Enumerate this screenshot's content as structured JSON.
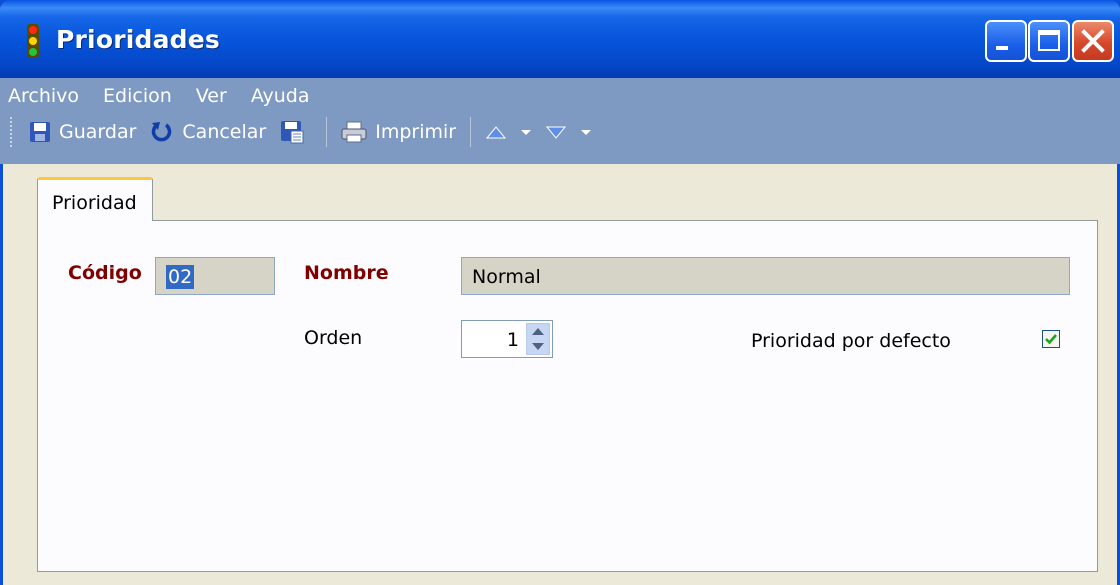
{
  "window": {
    "title": "Prioridades",
    "controls": [
      "minimize-icon",
      "maximize-icon",
      "close-icon"
    ]
  },
  "menu": {
    "items": [
      "Archivo",
      "Edicion",
      "Ver",
      "Ayuda"
    ]
  },
  "toolbar": {
    "save_label": "Guardar",
    "cancel_label": "Cancelar",
    "print_label": "Imprimir",
    "icons": [
      "save-icon",
      "undo-icon",
      "save-as-icon",
      "print-icon",
      "nav-up-icon",
      "nav-down-icon"
    ]
  },
  "tabs": [
    {
      "label": "Prioridad",
      "active": true
    }
  ],
  "form": {
    "codigo": {
      "label": "Código",
      "value": "02"
    },
    "nombre": {
      "label": "Nombre",
      "value": "Normal"
    },
    "orden": {
      "label": "Orden",
      "value": "1"
    },
    "default": {
      "label": "Prioridad por defecto",
      "checked": true
    }
  },
  "colors": {
    "titlebar": "#0553d8",
    "menu_band": "#7e99c2",
    "required_label": "#800000",
    "tab_highlight": "#ffc83c",
    "selection": "#316ac5"
  }
}
